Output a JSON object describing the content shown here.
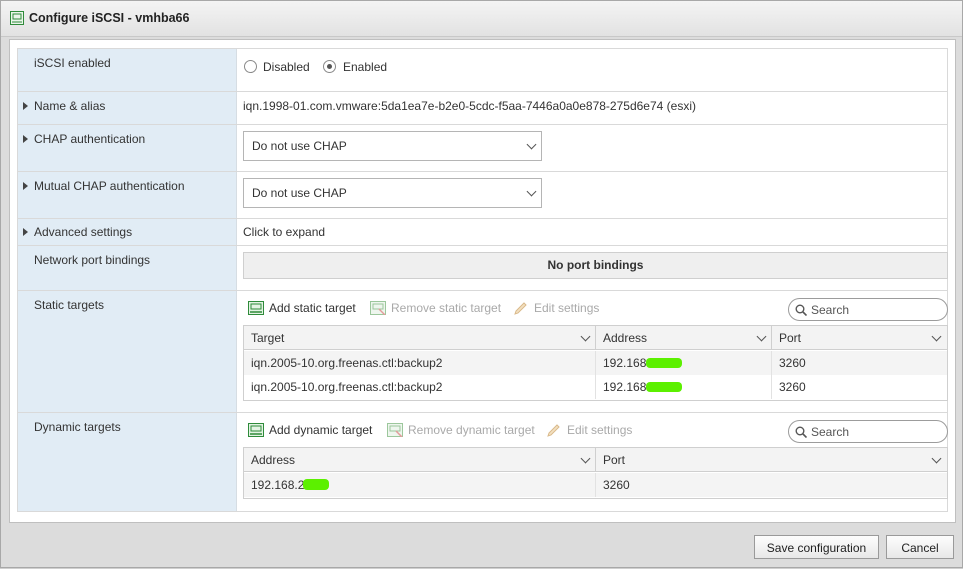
{
  "window": {
    "title": "Configure iSCSI - vmhba66"
  },
  "rows": {
    "iscsi_enabled": {
      "label": "iSCSI enabled",
      "options": [
        "Disabled",
        "Enabled"
      ],
      "selected": "Enabled"
    },
    "name_alias": {
      "label": "Name & alias",
      "value": "iqn.1998-01.com.vmware:5da1ea7e-b2e0-5cdc-f5aa-7446a0a0e878-275d6e74 (esxi)"
    },
    "chap": {
      "label": "CHAP authentication",
      "value": "Do not use CHAP"
    },
    "mutual_chap": {
      "label": "Mutual CHAP authentication",
      "value": "Do not use CHAP"
    },
    "advanced": {
      "label": "Advanced settings",
      "value": "Click to expand"
    },
    "port_bindings": {
      "label": "Network port bindings",
      "value": "No port bindings"
    },
    "static_targets": {
      "label": "Static targets",
      "toolbar": {
        "add": "Add static target",
        "remove": "Remove static target",
        "edit": "Edit settings",
        "search_placeholder": "Search"
      },
      "columns": [
        "Target",
        "Address",
        "Port"
      ],
      "rows": [
        [
          "iqn.2005-10.org.freenas.ctl:backup2",
          "192.168",
          "3260"
        ],
        [
          "iqn.2005-10.org.freenas.ctl:backup2",
          "192.168",
          "3260"
        ]
      ]
    },
    "dynamic_targets": {
      "label": "Dynamic targets",
      "toolbar": {
        "add": "Add dynamic target",
        "remove": "Remove dynamic target",
        "edit": "Edit settings",
        "search_placeholder": "Search"
      },
      "columns": [
        "Address",
        "Port"
      ],
      "rows": [
        [
          "192.168.2",
          "3260"
        ]
      ]
    }
  },
  "footer": {
    "save": "Save configuration",
    "cancel": "Cancel"
  },
  "colors": {
    "label_bg": "#e1ecf5",
    "redaction": "#5cf000",
    "icon_green": "#2e8b3a"
  }
}
